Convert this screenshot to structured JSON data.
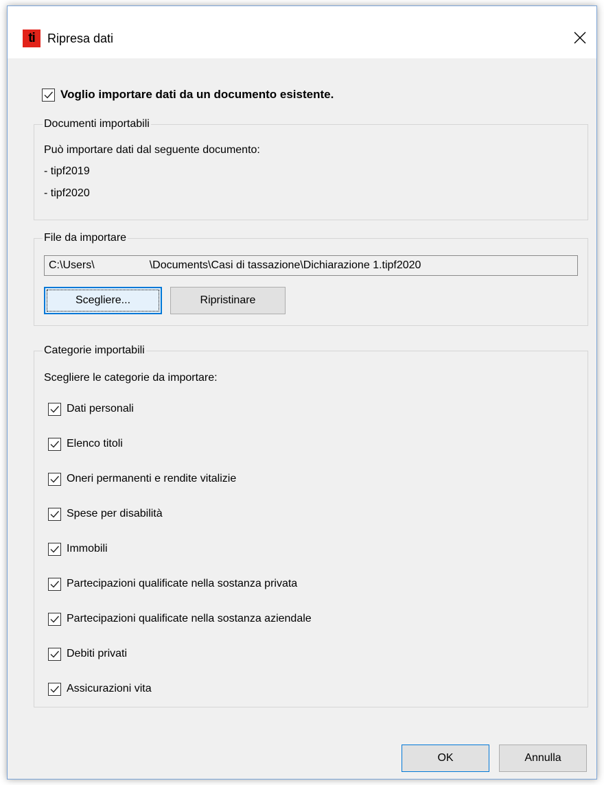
{
  "window": {
    "title": "Ripresa dati",
    "icon_text": "ti",
    "icon_color": "#e2231a"
  },
  "main_checkbox": {
    "label": "Voglio importare dati da un documento esistente.",
    "checked": true
  },
  "documents_group": {
    "legend": "Documenti importabili",
    "intro": "Può importare dati dal seguente documento:",
    "documents": [
      "- tipf2019",
      "- tipf2020"
    ]
  },
  "file_group": {
    "legend": "File da importare",
    "path": "C:\\Users\\                  \\Documents\\Casi di tassazione\\Dichiarazione 1.tipf2020",
    "choose_label": "Scegliere...",
    "reset_label": "Ripristinare"
  },
  "categories_group": {
    "legend": "Categorie importabili",
    "intro": "Scegliere le categorie da importare:",
    "items": [
      {
        "label": "Dati personali",
        "checked": true
      },
      {
        "label": "Elenco titoli",
        "checked": true
      },
      {
        "label": "Oneri permanenti e rendite vitalizie",
        "checked": true
      },
      {
        "label": "Spese per disabilità",
        "checked": true
      },
      {
        "label": "Immobili",
        "checked": true
      },
      {
        "label": "Partecipazioni qualificate nella sostanza privata",
        "checked": true
      },
      {
        "label": "Partecipazioni qualificate nella sostanza aziendale",
        "checked": true
      },
      {
        "label": "Debiti privati",
        "checked": true
      },
      {
        "label": "Assicurazioni vita",
        "checked": true
      }
    ]
  },
  "footer": {
    "ok_label": "OK",
    "cancel_label": "Annulla"
  },
  "colors": {
    "accent": "#0078d7",
    "dialog_bg": "#f0f0f0"
  }
}
